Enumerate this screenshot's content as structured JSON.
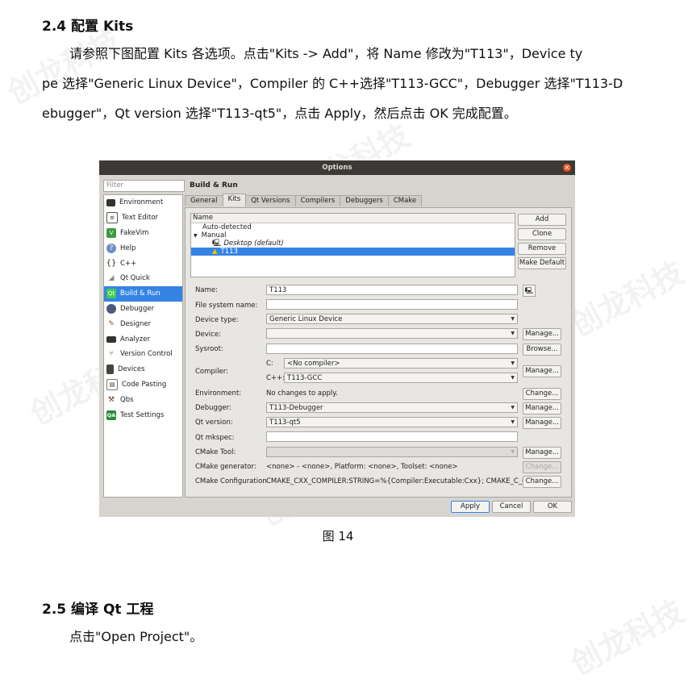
{
  "heading1": "2.4 配置 Kits",
  "paragraph1": {
    "lines": [
      "请参照下图配置 Kits 各选项。点击\"Kits  ->  Add\"，将 Name 修改为\"T113\"，Device  ty",
      "pe 选择\"Generic  Linux  Device\"，Compiler 的 C++选择\"T113-GCC\"，Debugger 选择\"T113-D",
      "ebugger\"，Qt  version 选择\"T113-qt5\"，点击 Apply，然后点击 OK 完成配置。"
    ]
  },
  "watermark": "创龙科技",
  "dialog": {
    "title": "Options",
    "filter_placeholder": "Filter",
    "nav_items": [
      {
        "label": "Environment",
        "icon": "monitor-icon"
      },
      {
        "label": "Text Editor",
        "icon": "text-editor-icon"
      },
      {
        "label": "FakeVim",
        "icon": "fakevim-icon"
      },
      {
        "label": "Help",
        "icon": "help-icon"
      },
      {
        "label": "C++",
        "icon": "cpp-braces-icon"
      },
      {
        "label": "Qt Quick",
        "icon": "qt-quick-icon"
      },
      {
        "label": "Build & Run",
        "icon": "build-run-icon"
      },
      {
        "label": "Debugger",
        "icon": "debugger-icon"
      },
      {
        "label": "Designer",
        "icon": "designer-icon"
      },
      {
        "label": "Analyzer",
        "icon": "analyzer-icon"
      },
      {
        "label": "Version Control",
        "icon": "version-control-icon"
      },
      {
        "label": "Devices",
        "icon": "devices-icon"
      },
      {
        "label": "Code Pasting",
        "icon": "code-pasting-icon"
      },
      {
        "label": "Qbs",
        "icon": "qbs-icon"
      },
      {
        "label": "Test Settings",
        "icon": "qa-icon"
      }
    ],
    "selected_nav": "Build & Run",
    "panel_title": "Build & Run",
    "tabs": [
      "General",
      "Kits",
      "Qt Versions",
      "Compilers",
      "Debuggers",
      "CMake"
    ],
    "active_tab": "Kits",
    "tree": {
      "header": "Name",
      "rows": [
        "Auto-detected",
        "Manual",
        "Desktop (default)",
        "T113"
      ]
    },
    "side_buttons": {
      "add": "Add",
      "clone": "Clone",
      "remove": "Remove",
      "make_default": "Make Default"
    },
    "form": {
      "name_label": "Name:",
      "name_value": "T113",
      "fs_name_label": "File system name:",
      "fs_name_value": "",
      "device_type_label": "Device type:",
      "device_type_value": "Generic Linux Device",
      "device_label": "Device:",
      "device_value": "",
      "sysroot_label": "Sysroot:",
      "sysroot_value": "",
      "compiler_label": "Compiler:",
      "compiler_c_label": "C:",
      "compiler_c_value": "<No compiler>",
      "compiler_cpp_label": "C++:",
      "compiler_cpp_value": "T113-GCC",
      "environment_label": "Environment:",
      "environment_value": "No changes to apply.",
      "debugger_label": "Debugger:",
      "debugger_value": "T113-Debugger",
      "qt_version_label": "Qt version:",
      "qt_version_value": "T113-qt5",
      "qt_mkspec_label": "Qt mkspec:",
      "qt_mkspec_value": "",
      "cmake_tool_label": "CMake Tool:",
      "cmake_tool_value": "",
      "cmake_generator_label": "CMake generator:",
      "cmake_generator_value": "<none> - <none>, Platform: <none>, Toolset: <none>",
      "cmake_config_label": "CMake Configuration",
      "cmake_config_value": "CMAKE_CXX_COMPILER:STRING=%{Compiler:Executable:Cxx}; CMAKE_C_C..."
    },
    "buttons": {
      "manage": "Manage...",
      "browse": "Browse...",
      "change": "Change...",
      "apply": "Apply",
      "cancel": "Cancel",
      "ok": "OK"
    }
  },
  "caption": "图   14",
  "heading2": "2.5 编译 Qt 工程",
  "paragraph2": "点击\"Open  Project\"。",
  "colors": {
    "selection": "#3584e4",
    "titlebar": "#3b3a36",
    "close": "#e9541f",
    "warning": "#f2c200"
  }
}
